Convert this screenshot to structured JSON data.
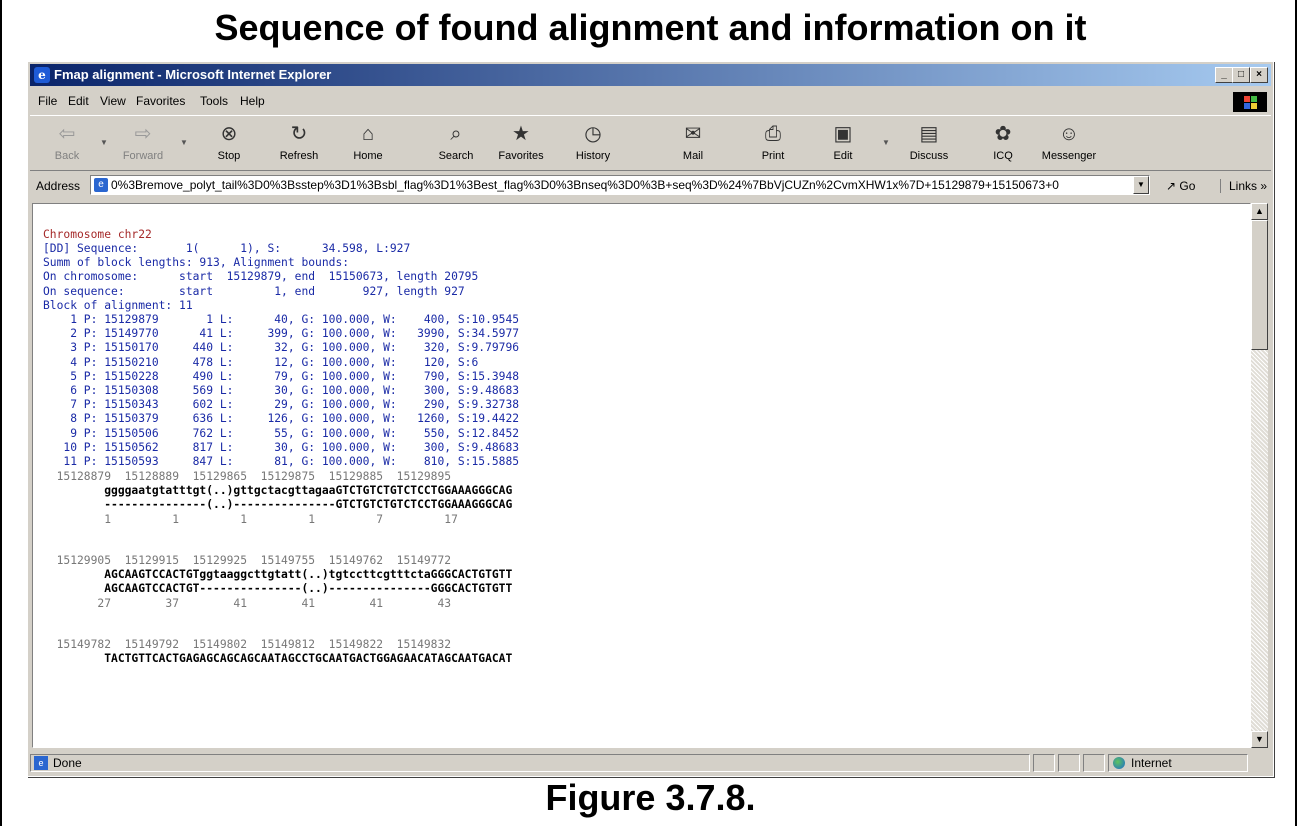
{
  "heading": "Sequence of found alignment and information on it",
  "caption": "Figure 3.7.8.",
  "window": {
    "title": "Fmap alignment - Microsoft Internet Explorer",
    "min_label": "_",
    "max_label": "□",
    "close_label": "×"
  },
  "menu": [
    "File",
    "Edit",
    "View",
    "Favorites",
    "Tools",
    "Help"
  ],
  "toolbar": {
    "back": "Back",
    "forward": "Forward",
    "stop": "Stop",
    "refresh": "Refresh",
    "home": "Home",
    "search": "Search",
    "favorites": "Favorites",
    "history": "History",
    "mail": "Mail",
    "print": "Print",
    "edit": "Edit",
    "discuss": "Discuss",
    "icq": "ICQ",
    "messenger": "Messenger"
  },
  "address": {
    "label": "Address",
    "value": "0%3Bremove_polyt_tail%3D0%3Bsstep%3D1%3Bsbl_flag%3D1%3Best_flag%3D0%3Bnseq%3D0%3B+seq%3D%24%7BbVjCUZn%2CvmXHW1x%7D+15129879+15150673+0",
    "go": "Go",
    "links": "Links »"
  },
  "content": {
    "chromosome": "Chromosome chr22",
    "info_lines": [
      "[DD] Sequence:       1(      1), S:      34.598, L:927",
      "Summ of block lengths: 913, Alignment bounds:",
      "On chromosome:      start  15129879, end  15150673, length 20795",
      "On sequence:        start         1, end       927, length 927",
      "Block of alignment: 11"
    ],
    "blocks": [
      "    1 P: 15129879       1 L:      40, G: 100.000, W:    400, S:10.9545",
      "    2 P: 15149770      41 L:     399, G: 100.000, W:   3990, S:34.5977",
      "    3 P: 15150170     440 L:      32, G: 100.000, W:    320, S:9.79796",
      "    4 P: 15150210     478 L:      12, G: 100.000, W:    120, S:6",
      "    5 P: 15150228     490 L:      79, G: 100.000, W:    790, S:15.3948",
      "    6 P: 15150308     569 L:      30, G: 100.000, W:    300, S:9.48683",
      "    7 P: 15150343     602 L:      29, G: 100.000, W:    290, S:9.32738",
      "    8 P: 15150379     636 L:     126, G: 100.000, W:   1260, S:19.4422",
      "    9 P: 15150506     762 L:      55, G: 100.000, W:    550, S:12.8452",
      "   10 P: 15150562     817 L:      30, G: 100.000, W:    300, S:9.48683",
      "   11 P: 15150593     847 L:      81, G: 100.000, W:    810, S:15.5885"
    ],
    "alignments": [
      {
        "coords": "  15128879  15128889  15129865  15129875  15129885  15129895",
        "seq_top": "         ggggaatgtatttgt(..)gttgctacgttagaaGTCTGTCTGTCTCCTGGAAAGGGCAG",
        "seq_bottom": "         ---------------(..)---------------GTCTGTCTGTCTCCTGGAAAGGGCAG",
        "positions": "         1         1         1         1         7         17"
      },
      {
        "coords": "  15129905  15129915  15129925  15149755  15149762  15149772",
        "seq_top": "         AGCAAGTCCACTGTggtaaggcttgtatt(..)tgtccttcgtttctaGGGCACTGTGTT",
        "seq_bottom": "         AGCAAGTCCACTGT---------------(..)---------------GGGCACTGTGTT",
        "positions": "        27        37        41        41        41        43"
      },
      {
        "coords": "  15149782  15149792  15149802  15149812  15149822  15149832",
        "seq_top": "         TACTGTTCACTGAGAGCAGCAGCAATAGCCTGCAATGACTGGAGAACATAGCAATGACAT",
        "seq_bottom": "",
        "positions": ""
      }
    ]
  },
  "status": {
    "text": "Done",
    "zone": "Internet"
  },
  "colors": {
    "titlebar_start": "#0a246a",
    "chrome": "#d4d0c8",
    "text_red": "#a52a2a",
    "text_blue": "#1a2aa6"
  }
}
